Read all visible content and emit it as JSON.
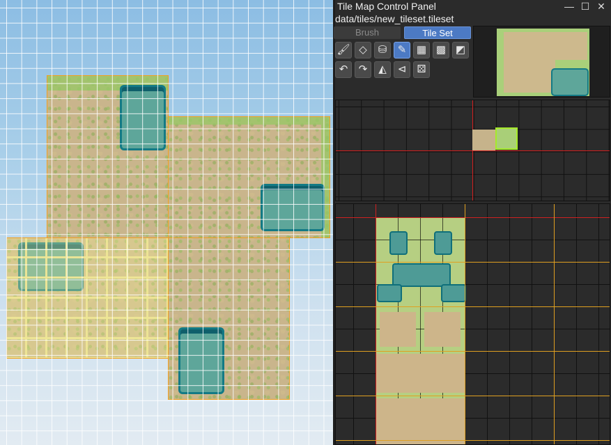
{
  "panel": {
    "title": "Tile Map Control Panel",
    "tileset_path": "data/tiles/new_tileset.tileset",
    "window_buttons": {
      "minimize": "—",
      "maximize": "☐",
      "close": "✕"
    }
  },
  "modes": {
    "brush_label": "Brush",
    "tileset_label": "Tile Set",
    "active": "Tile Set"
  },
  "tools": [
    {
      "name": "paint-brush-icon",
      "glyph": "🖌"
    },
    {
      "name": "eraser-icon",
      "glyph": "◇"
    },
    {
      "name": "fill-bucket-icon",
      "glyph": "⛁"
    },
    {
      "name": "eyedropper-icon",
      "glyph": "✎",
      "active": true
    },
    {
      "name": "grid-fill-icon",
      "glyph": "▦"
    },
    {
      "name": "grid-pattern-icon",
      "glyph": "▩"
    },
    {
      "name": "diagonal-pattern-icon",
      "glyph": "◩"
    },
    {
      "name": "rotate-left-icon",
      "glyph": "↶"
    },
    {
      "name": "rotate-right-icon",
      "glyph": "↷"
    },
    {
      "name": "flip-horizontal-icon",
      "glyph": "◭"
    },
    {
      "name": "flip-vertical-icon",
      "glyph": "⊲"
    },
    {
      "name": "random-dice-icon",
      "glyph": "⚄"
    }
  ],
  "colors": {
    "accent": "#4c7ac4",
    "selection_highlight": "#a6ea2a",
    "origin_axis": "#d02020",
    "chunk_outline": "#e0a020"
  }
}
